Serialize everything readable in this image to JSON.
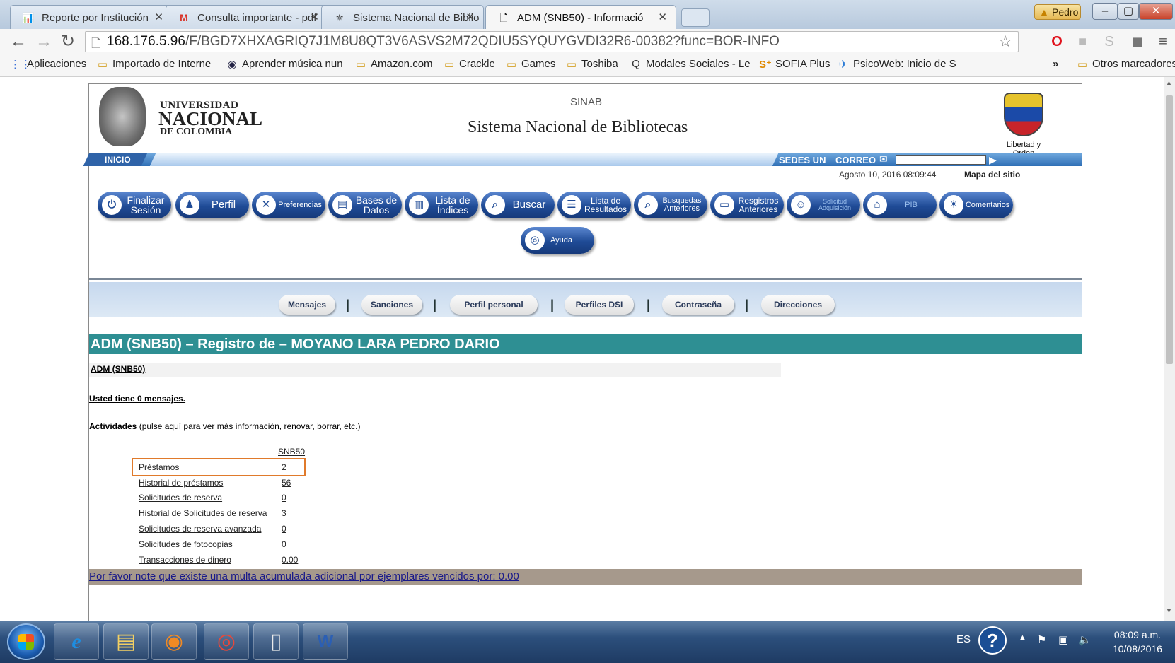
{
  "browser": {
    "tabs": [
      {
        "label": "Reporte por Institución",
        "icon": "report-favicon"
      },
      {
        "label": "Consulta importante - pdf",
        "icon": "gmail-favicon"
      },
      {
        "label": "Sistema Nacional de Biblio",
        "icon": "library-favicon"
      },
      {
        "label": "ADM (SNB50) - Informació",
        "icon": "page-favicon"
      }
    ],
    "user_badge": "Pedro",
    "url_host": "168.176.5.96",
    "url_path": "/F/BGD7XHXAGRIQ7J1M8U8QT3V6ASVS2M72QDIU5SYQUYGVDI32R6-00382?func=BOR-INFO",
    "bookmarks": [
      {
        "label": "Aplicaciones",
        "icon": "apps-icon"
      },
      {
        "label": "Importado de Interne",
        "icon": "folder-icon"
      },
      {
        "label": "Aprender música nun",
        "icon": "eye-icon"
      },
      {
        "label": "Amazon.com",
        "icon": "folder-icon"
      },
      {
        "label": "Crackle",
        "icon": "folder-icon"
      },
      {
        "label": "Games",
        "icon": "folder-icon"
      },
      {
        "label": "Toshiba",
        "icon": "folder-icon"
      },
      {
        "label": "Modales Sociales - Le",
        "icon": "q-icon"
      },
      {
        "label": "SOFIA Plus",
        "icon": "sofia-icon"
      },
      {
        "label": "PsicoWeb: Inicio de S",
        "icon": "psico-icon"
      }
    ],
    "other_bookmarks": "Otros marcadores",
    "overflow": "»"
  },
  "header": {
    "logo_line1": "UNIVERSIDAD",
    "logo_line2": "NACIONAL",
    "logo_line3": "DE COLOMBIA",
    "sinab": "SINAB",
    "title": "Sistema Nacional de Bibliotecas",
    "escudo_caption": "Libertad y Orden"
  },
  "topbar": {
    "inicio": "INICIO",
    "sedes": "SEDES UN",
    "correo": "CORREO",
    "date": "Agosto 10, 2016 08:09:44",
    "mapa": "Mapa del sitio"
  },
  "menu": [
    {
      "label": "Finalizar Sesión",
      "icon": "logout-icon",
      "glyph": "⏻"
    },
    {
      "label": "Perfil",
      "icon": "person-icon",
      "glyph": "👤"
    },
    {
      "label": "Preferencias",
      "icon": "tools-icon",
      "glyph": "✕"
    },
    {
      "label": "Bases de Datos",
      "icon": "database-icon",
      "glyph": "▤"
    },
    {
      "label": "Lista de Índices",
      "icon": "book-icon",
      "glyph": "📖"
    },
    {
      "label": "Buscar",
      "icon": "search-icon",
      "glyph": "⌕"
    },
    {
      "label": "Lista de Resultados",
      "icon": "list-icon",
      "glyph": "☰"
    },
    {
      "label": "Busquedas Anteriores",
      "icon": "magnifier-icon",
      "glyph": "⌕"
    },
    {
      "label": "Resgistros Anteriores",
      "icon": "records-icon",
      "glyph": "▭"
    },
    {
      "label": "Solicitud Adquisición",
      "icon": "users-icon",
      "glyph": "👥"
    },
    {
      "label": "PIB",
      "icon": "home-icon",
      "glyph": "⌂"
    },
    {
      "label": "Comentarios",
      "icon": "lightbulb-icon",
      "glyph": "💡"
    },
    {
      "label": "Ayuda",
      "icon": "lifebuoy-icon",
      "glyph": "◎"
    }
  ],
  "subnav": [
    "Mensajes",
    "Sanciones",
    "Perfil personal",
    "Perfiles DSI",
    "Contraseña",
    "Direcciones"
  ],
  "record": {
    "title": "ADM (SNB50) – Registro de – MOYANO LARA PEDRO DARIO",
    "adm_link": "ADM (SNB50)",
    "messages": "Usted tiene 0 mensajes.",
    "activities_label": "Actividades",
    "activities_hint": "(pulse aquí para ver más información, renovar, borrar, etc.)",
    "column_header": "SNB50",
    "rows": [
      {
        "label": "Préstamos",
        "value": "2"
      },
      {
        "label": "Historial de préstamos",
        "value": "56"
      },
      {
        "label": "Solicitudes de reserva",
        "value": "0"
      },
      {
        "label": "Historial de Solicitudes de reserva",
        "value": "3"
      },
      {
        "label": "Solicitudes de reserva avanzada",
        "value": "0"
      },
      {
        "label": "Solicitudes de fotocopias",
        "value": "0"
      },
      {
        "label": "Transacciones de dinero",
        "value": "0.00"
      }
    ],
    "fine_note": "Por favor note que existe una multa acumulada adicional por ejemplares vencidos por: 0.00"
  },
  "taskbar": {
    "lang": "ES",
    "time": "08:09 a.m.",
    "date": "10/08/2016"
  }
}
